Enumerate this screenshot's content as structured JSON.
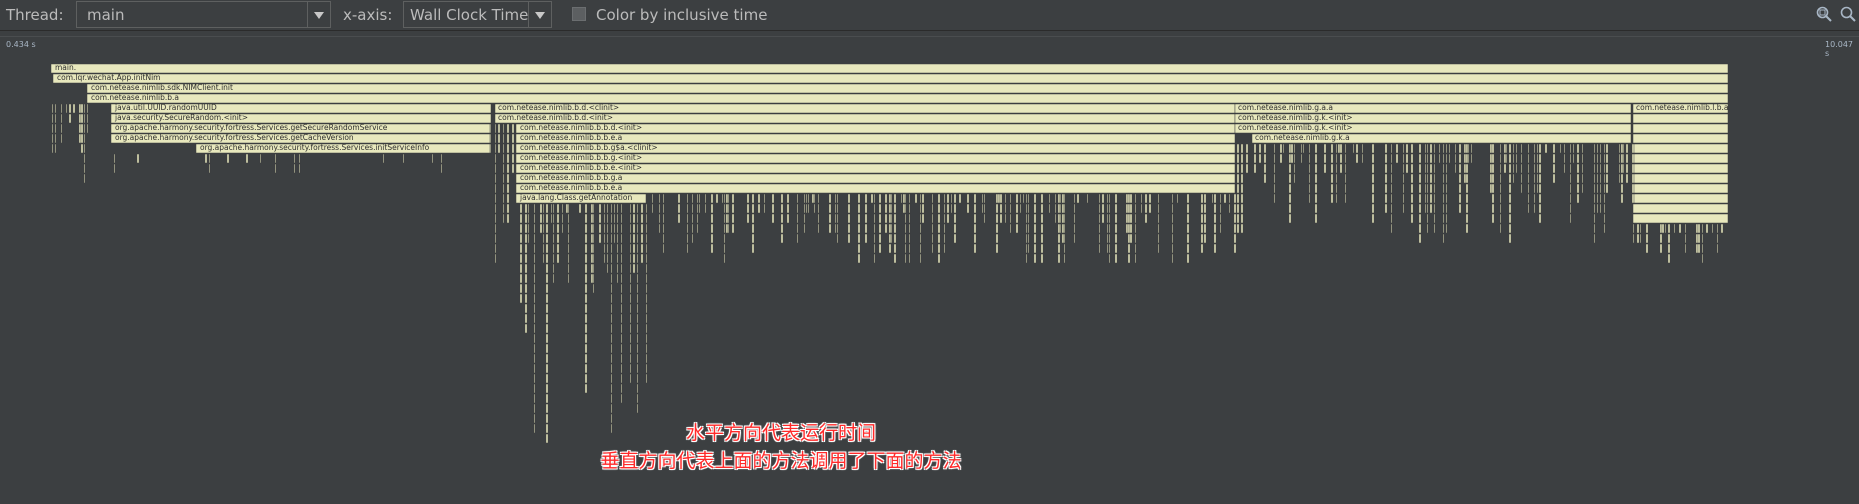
{
  "toolbar": {
    "thread_label": "Thread:",
    "thread_value": "main",
    "xaxis_label": "x-axis:",
    "xaxis_value": "Wall Clock Time",
    "color_checkbox_label": "Color by inclusive time",
    "color_checkbox_checked": false,
    "icons": [
      "zoom-fit-icon",
      "search-icon"
    ]
  },
  "timeline": {
    "start_label": "0.434 s",
    "end_label": "10.047 s"
  },
  "flame_colors": {
    "frame": "#e8e8bd",
    "background": "#3c3f41",
    "text": "#2e2e2e"
  },
  "method_labels": [
    "main.",
    "com.lqr.wechat.App.initNim",
    "com.netease.nimlib.sdk.NIMClient.init",
    "com.netease.nimlib.b.a",
    "java.util.UUID.randomUUID",
    "java.security.SecureRandom.<init>",
    "org.apache.harmony.security.fortress.Services.getSecureRandomService",
    "org.apache.harmony.security.fortress.Services.getCacheVersion",
    "org.apache.harmony.security.fortress.Services.initServiceInfo",
    "com.netease.nimlib.b.d.<clinit>",
    "com.netease.nimlib.b.d.<init>",
    "com.netease.nimlib.b.b.d.<init>",
    "com.netease.nimlib.b.b.e.a",
    "com.netease.nimlib.b.b.g$a.<clinit>",
    "com.netease.nimlib.b.b.g.<init>",
    "com.netease.nimlib.b.b.e.<init>",
    "com.netease.nimlib.b.b.g.a",
    "com.netease.nimlib.b.b.e.a",
    "java.lang.Class.getAnnotation",
    "com.netease.nimlib.g.a.a",
    "com.netease.nimlib.g.k.<init>",
    "com.netease.nimlib.g.k.<init>",
    "com.netease.nimlib.g.k.a",
    "com.netease.nimlib.l.b.a"
  ],
  "annotation": {
    "line1": "水平方向代表运行时间",
    "line2": "垂直方向代表上面的方法调用了下面的方法"
  }
}
